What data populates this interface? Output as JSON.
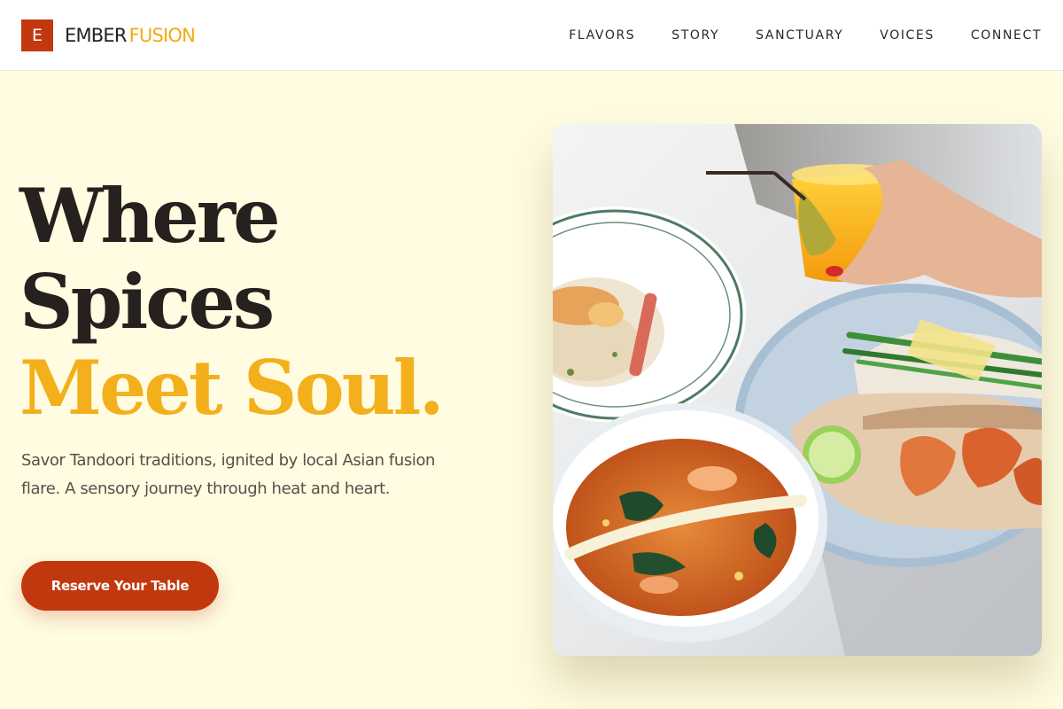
{
  "brand": {
    "mark": "E",
    "name_part1": "EMBER",
    "name_part2": "FUSION",
    "primary_color": "#c1380f",
    "accent_color": "#f3b01c"
  },
  "nav": {
    "items": [
      {
        "label": "FLAVORS"
      },
      {
        "label": "STORY"
      },
      {
        "label": "SANCTUARY"
      },
      {
        "label": "VOICES"
      },
      {
        "label": "CONNECT"
      }
    ]
  },
  "hero": {
    "headline_line1": "Where",
    "headline_line2": "Spices",
    "headline_line3": "Meet Soul.",
    "subtitle": "Savor Tandoori traditions, ignited by local Asian fusion flare. A sensory journey through heat and heart.",
    "cta_label": "Reserve Your Table"
  },
  "image": {
    "alt": "Asian fusion dishes with a hand holding an orange drink",
    "icon": "food-photo"
  }
}
